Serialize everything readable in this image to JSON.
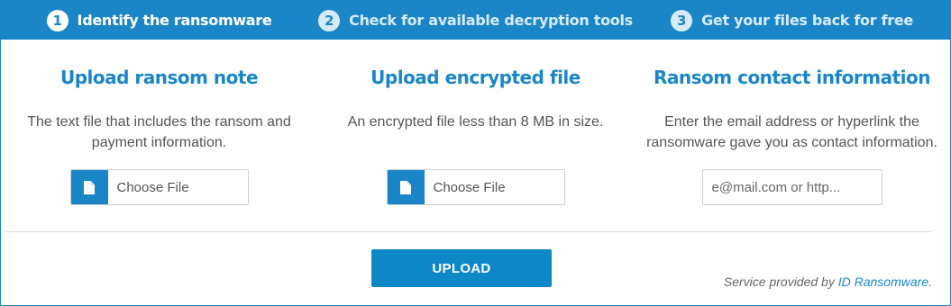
{
  "steps": [
    {
      "number": "1",
      "label": "Identify the ransomware"
    },
    {
      "number": "2",
      "label": "Check for available decryption tools"
    },
    {
      "number": "3",
      "label": "Get your files back for free"
    }
  ],
  "columns": {
    "ransom_note": {
      "title": "Upload ransom note",
      "description": "The text file that includes the ransom and payment information.",
      "button_label": "Choose File",
      "icon": "file-icon"
    },
    "encrypted_file": {
      "title": "Upload encrypted file",
      "description": "An encrypted file less than 8 MB in size.",
      "button_label": "Choose File",
      "icon": "file-icon"
    },
    "contact": {
      "title": "Ransom contact information",
      "description": "Enter the email address or hyperlink the ransomware gave you as contact information.",
      "placeholder": "e@mail.com or http..."
    }
  },
  "upload_label": "UPLOAD",
  "footer": {
    "prefix": "Service provided by ",
    "link_text": "ID Ransomware",
    "suffix": "."
  },
  "colors": {
    "accent": "#1b86c7",
    "button": "#0e87c9",
    "text": "#555555"
  }
}
